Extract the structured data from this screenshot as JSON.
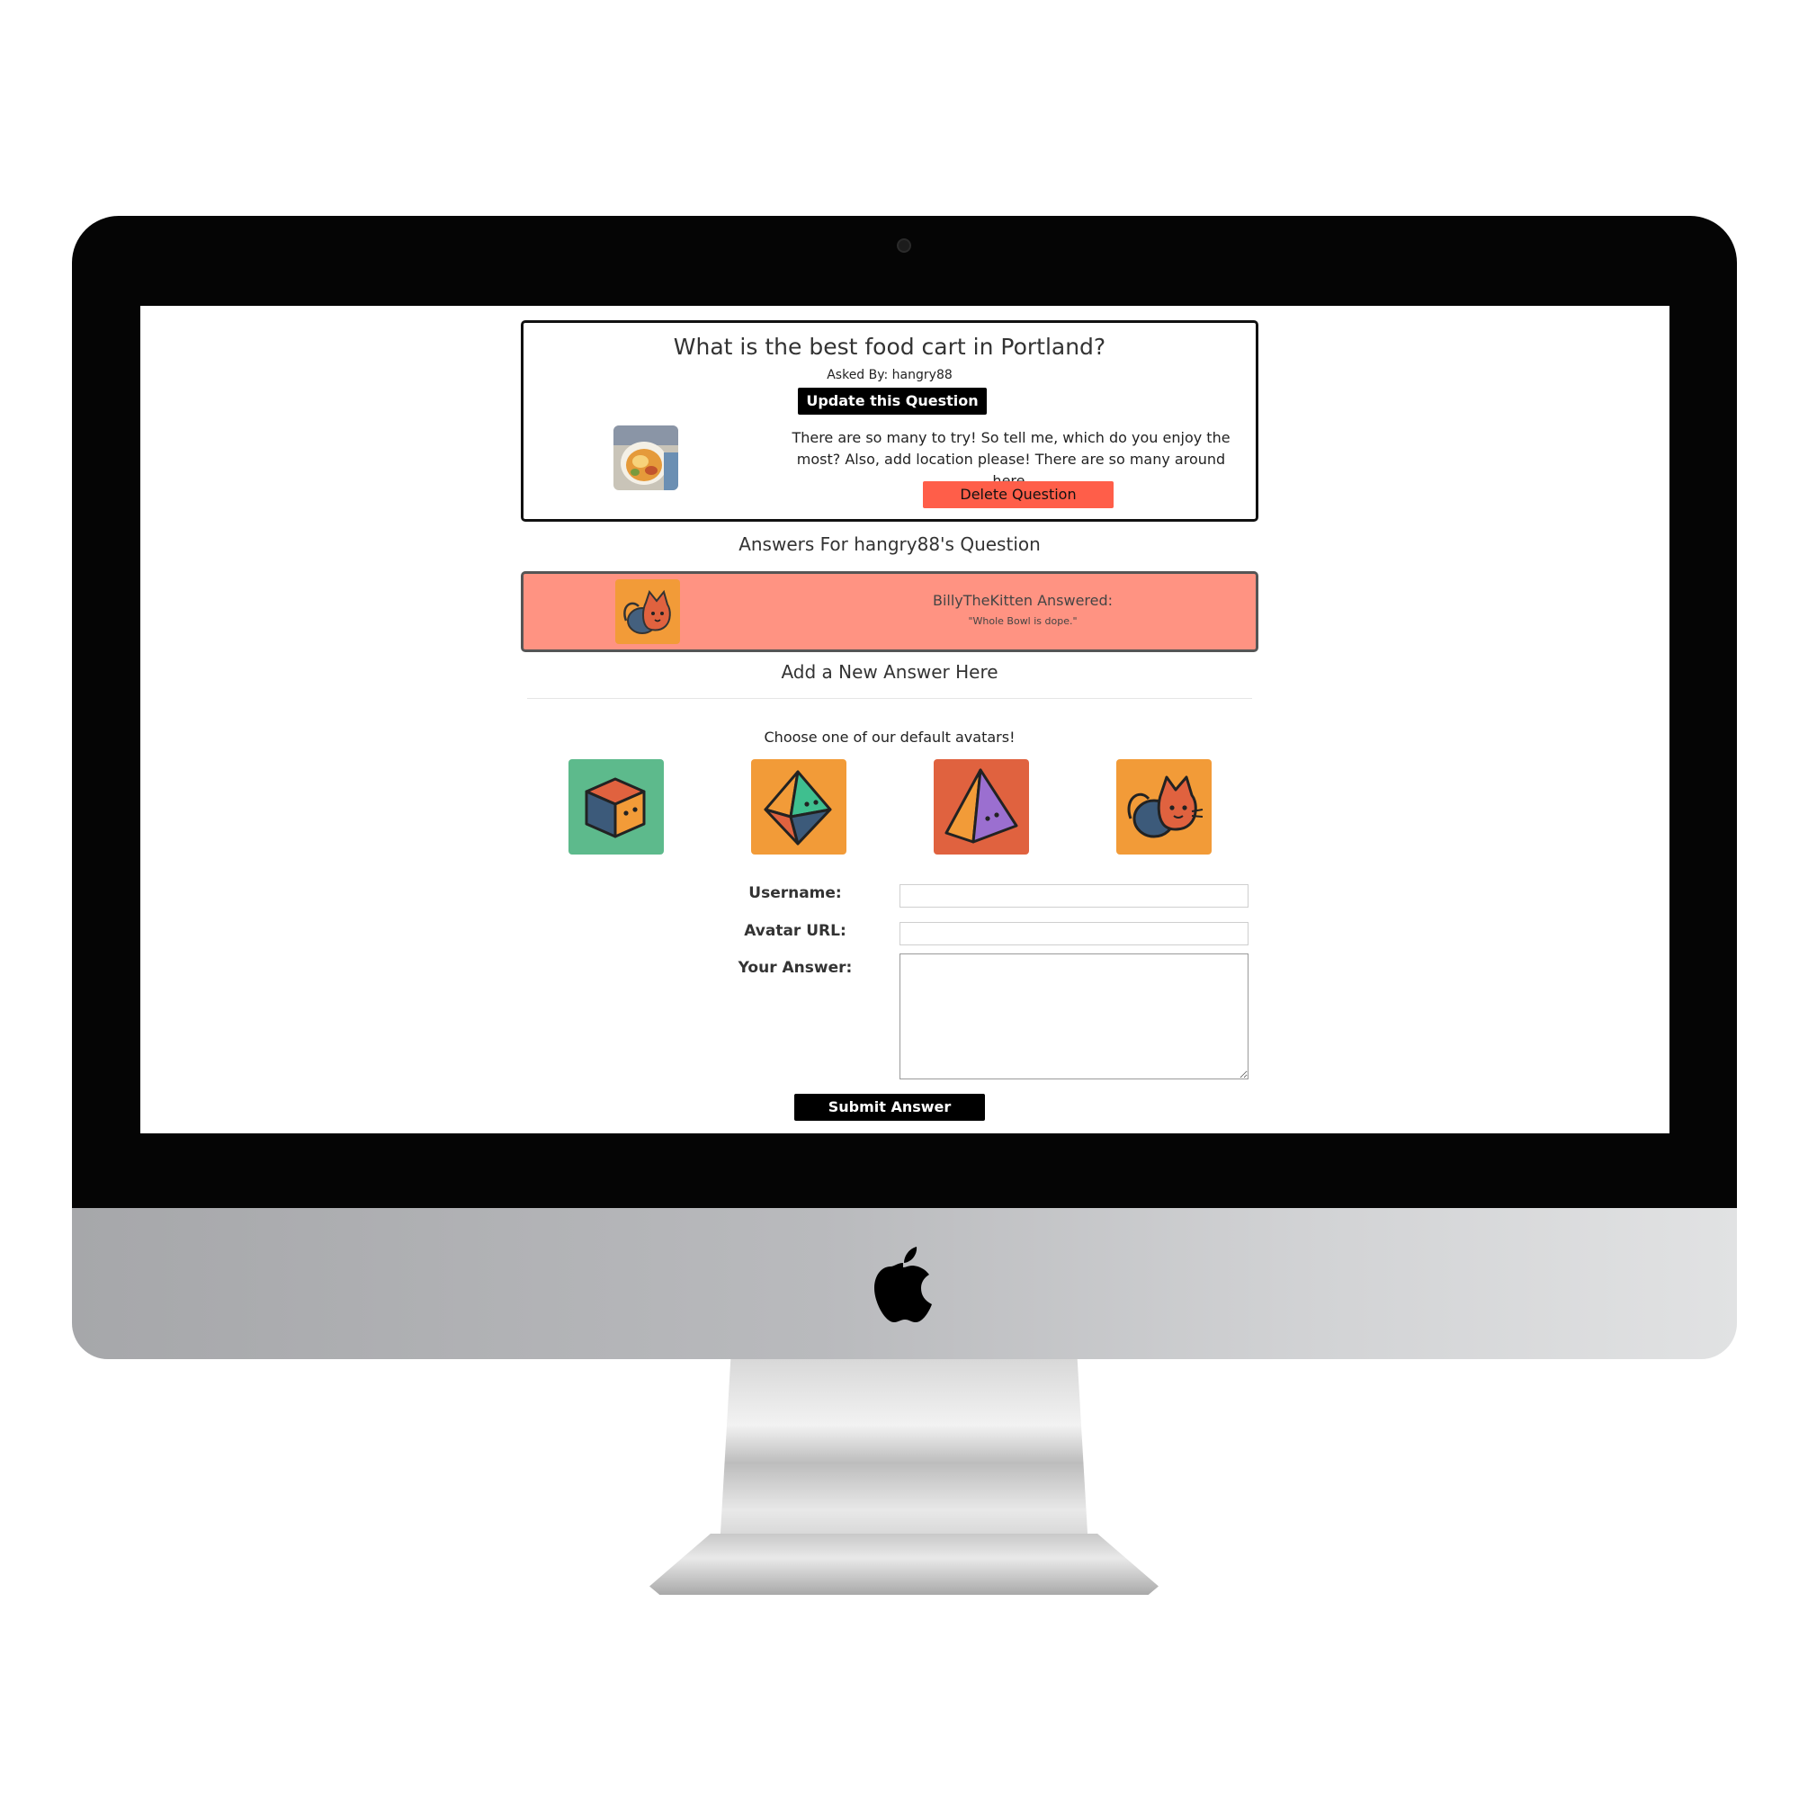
{
  "question": {
    "title": "What is the best food cart in Portland?",
    "asked_by": "Asked By: hangry88",
    "update_label": "Update this Question",
    "body": "There are so many to try! So tell me, which do you enjoy the most? Also, add location please! There are so many around here.",
    "delete_label": "Delete Question"
  },
  "answers": {
    "heading": "Answers For hangry88's Question",
    "items": [
      {
        "username": "BillyTheKitten Answered:",
        "text": "\"Whole Bowl is dope.\"",
        "avatar": "cat-avatar-icon"
      }
    ]
  },
  "new_answer": {
    "heading": "Add a New Answer Here",
    "avatar_prompt": "Choose one of our default avatars!",
    "avatars": [
      "cube-avatar-icon",
      "octahedron-avatar-icon",
      "pyramid-avatar-icon",
      "cat-avatar-icon"
    ],
    "username_label": "Username:",
    "username_value": "",
    "avatar_url_label": "Avatar URL:",
    "avatar_url_value": "",
    "answer_label": "Your Answer:",
    "answer_value": "",
    "submit_label": "Submit Answer"
  },
  "colors": {
    "answer_card": "#ff9382",
    "delete_button": "#ff5e49",
    "avatar_green": "#5dba8c",
    "avatar_orange": "#f29b38",
    "avatar_red": "#e0623f"
  }
}
